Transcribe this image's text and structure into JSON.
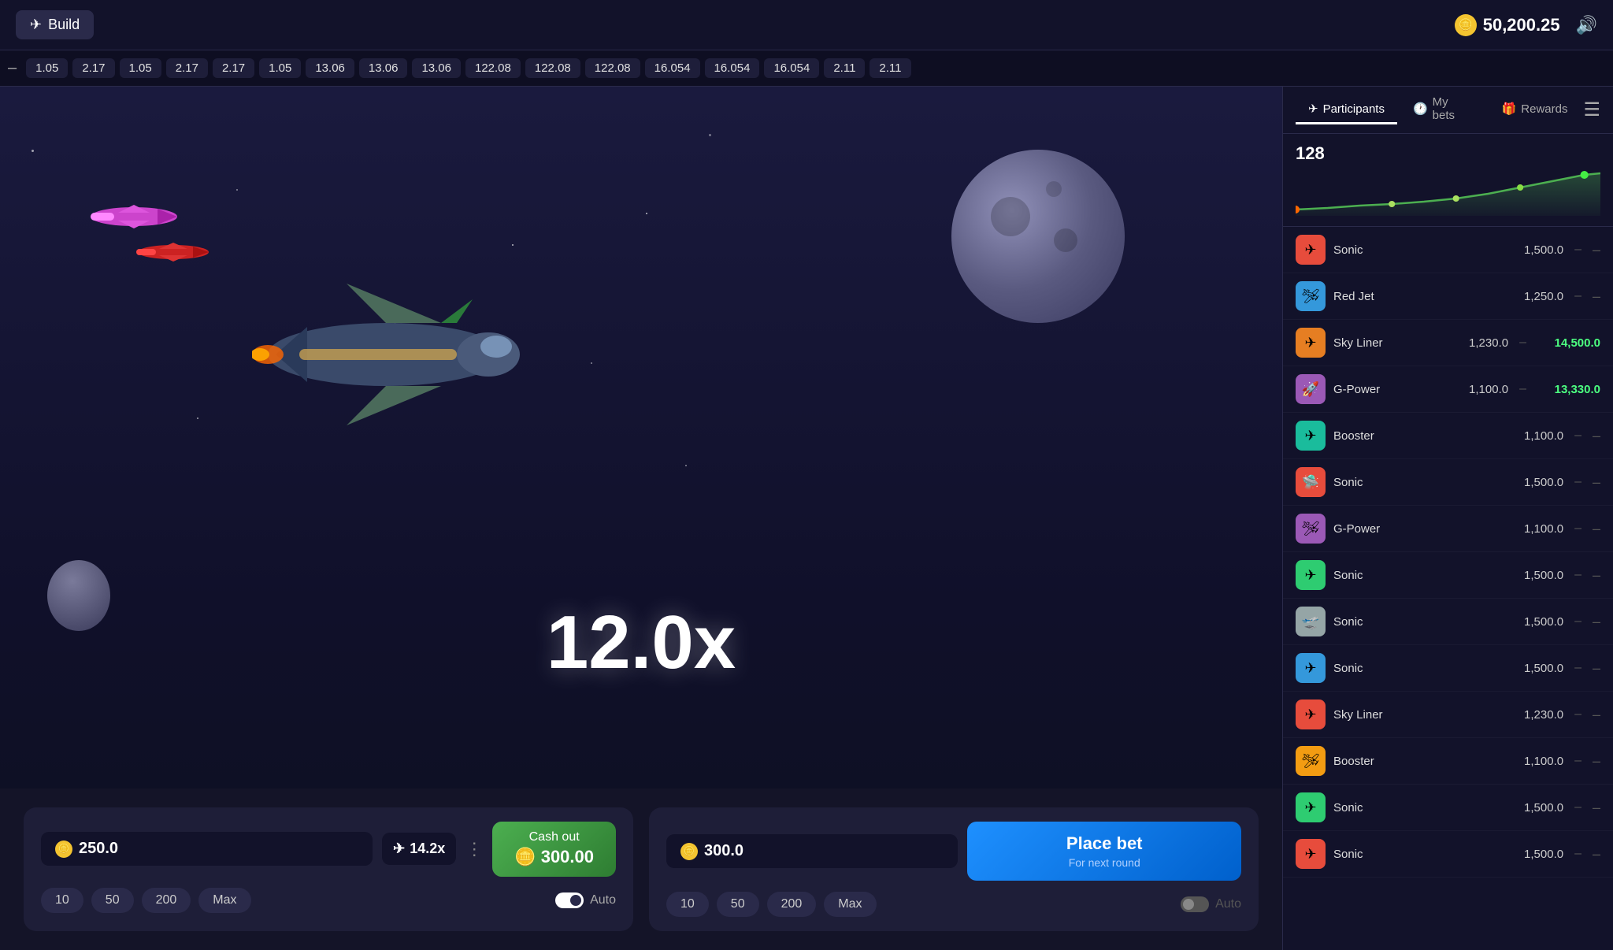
{
  "header": {
    "build_label": "Build",
    "balance": "50,200.25",
    "sound_icon": "🔊"
  },
  "ticker": {
    "minus": "–",
    "items": [
      "1.05",
      "2.17",
      "1.05",
      "2.17",
      "2.17",
      "1.05",
      "13.06",
      "13.06",
      "13.06",
      "122.08",
      "122.08",
      "122.08",
      "16.054",
      "16.054",
      "16.054",
      "2.11",
      "2.11"
    ]
  },
  "game": {
    "multiplier": "12.0x"
  },
  "bet_panel_1": {
    "amount": "250.0",
    "multiplier": "14.2x",
    "cashout_label": "Cash out",
    "cashout_amount": "300.00",
    "quick_btns": [
      "10",
      "50",
      "200",
      "Max"
    ],
    "auto_label": "Auto",
    "auto_on": true
  },
  "bet_panel_2": {
    "amount": "300.0",
    "place_bet_label": "Place bet",
    "place_bet_sub": "For next round",
    "quick_btns": [
      "10",
      "50",
      "200",
      "Max"
    ],
    "auto_label": "Auto",
    "auto_on": false
  },
  "right_panel": {
    "tabs": [
      {
        "label": "Participants",
        "icon": "✈",
        "active": true
      },
      {
        "label": "My bets",
        "icon": "🕐",
        "active": false
      },
      {
        "label": "Rewards",
        "icon": "🎁",
        "active": false
      }
    ],
    "chart_count": "128",
    "participants": [
      {
        "name": "Sonic",
        "bet": "1,500.0",
        "cashout": null
      },
      {
        "name": "Red Jet",
        "bet": "1,250.0",
        "cashout": null
      },
      {
        "name": "Sky Liner",
        "bet": "1,230.0",
        "cashout": "14,500.0"
      },
      {
        "name": "G-Power",
        "bet": "1,100.0",
        "cashout": "13,330.0"
      },
      {
        "name": "Booster",
        "bet": "1,100.0",
        "cashout": null
      },
      {
        "name": "Sonic",
        "bet": "1,500.0",
        "cashout": null
      },
      {
        "name": "G-Power",
        "bet": "1,100.0",
        "cashout": null
      },
      {
        "name": "Sonic",
        "bet": "1,500.0",
        "cashout": null
      },
      {
        "name": "Sonic",
        "bet": "1,500.0",
        "cashout": null
      },
      {
        "name": "Sonic",
        "bet": "1,500.0",
        "cashout": null
      },
      {
        "name": "Sky Liner",
        "bet": "1,230.0",
        "cashout": null
      },
      {
        "name": "Booster",
        "bet": "1,100.0",
        "cashout": null
      },
      {
        "name": "Sonic",
        "bet": "1,500.0",
        "cashout": null
      },
      {
        "name": "Sonic",
        "bet": "1,500.0",
        "cashout": null
      }
    ],
    "avatar_colors": [
      "#e74c3c",
      "#3498db",
      "#e67e22",
      "#9b59b6",
      "#1abc9c",
      "#e74c3c",
      "#9b59b6",
      "#2ecc71",
      "#95a5a6",
      "#3498db",
      "#e74c3c",
      "#f39c12",
      "#2ecc71",
      "#e74c3c"
    ]
  }
}
